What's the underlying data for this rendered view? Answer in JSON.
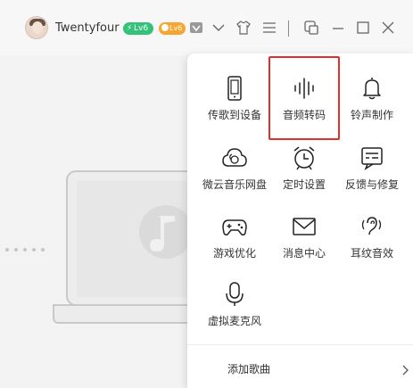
{
  "header": {
    "username": "Twentyfour",
    "vip_badge": "Lv6",
    "level_badge": "Lv6",
    "icons": [
      "avatar",
      "vip-badge",
      "level-badge",
      "vip-diamond-icon",
      "chevron-down-icon",
      "skin-shirt-icon",
      "menu-icon",
      "mini-mode-icon",
      "minimize-icon",
      "maximize-icon",
      "close-icon"
    ]
  },
  "menu": {
    "items": [
      {
        "label": "传歌到设备",
        "icon": "phone-icon"
      },
      {
        "label": "音频转码",
        "icon": "audio-wave-icon"
      },
      {
        "label": "铃声制作",
        "icon": "bell-icon"
      },
      {
        "label": "微云音乐网盘",
        "icon": "cloud-icon"
      },
      {
        "label": "定时设置",
        "icon": "alarm-clock-icon"
      },
      {
        "label": "反馈与修复",
        "icon": "feedback-icon"
      },
      {
        "label": "游戏优化",
        "icon": "gamepad-icon"
      },
      {
        "label": "消息中心",
        "icon": "mail-icon"
      },
      {
        "label": "耳纹音效",
        "icon": "ear-icon"
      },
      {
        "label": "虚拟麦克风",
        "icon": "microphone-icon"
      }
    ],
    "add_song": "添加歌曲",
    "highlighted_item": "音频转码"
  },
  "colors": {
    "highlight_border": "#e0302a",
    "vip_green": "#34c27a",
    "level_orange": "#f6a533"
  }
}
